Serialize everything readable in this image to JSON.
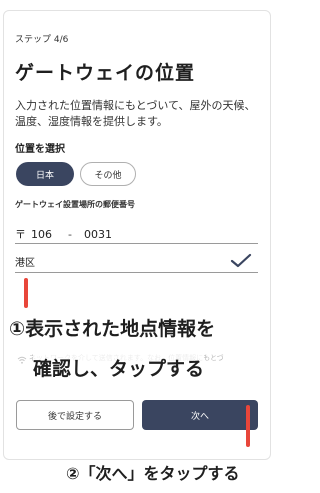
{
  "header": {
    "step": "ステップ 4/6",
    "title": "ゲートウェイの位置",
    "description": "入力された位置情報にもとづいて、屋外の天候、温度、湿度情報を提供します。"
  },
  "location": {
    "section_label": "位置を選択",
    "options": [
      "日本",
      "その他"
    ],
    "selected": "日本"
  },
  "postal": {
    "label": "ゲートウェイ設置場所の郵便番号",
    "mark": "〒",
    "part1": "106",
    "separator": "-",
    "part2": "0031"
  },
  "city": {
    "value": "港区"
  },
  "hidden_text": "ネットワークを介して送信されます。なお、位置情報にもとづ",
  "annotations": {
    "step1_line1": "①表示された地点情報を",
    "step1_line2": "確認し、タップする",
    "step2": "②「次へ」をタップする"
  },
  "buttons": {
    "later": "後で設定する",
    "next": "次へ"
  },
  "colors": {
    "primary": "#3a4560",
    "annotation_red": "#e8463a"
  },
  "icons": {
    "check": "check-icon",
    "wifi": "wifi-icon"
  }
}
